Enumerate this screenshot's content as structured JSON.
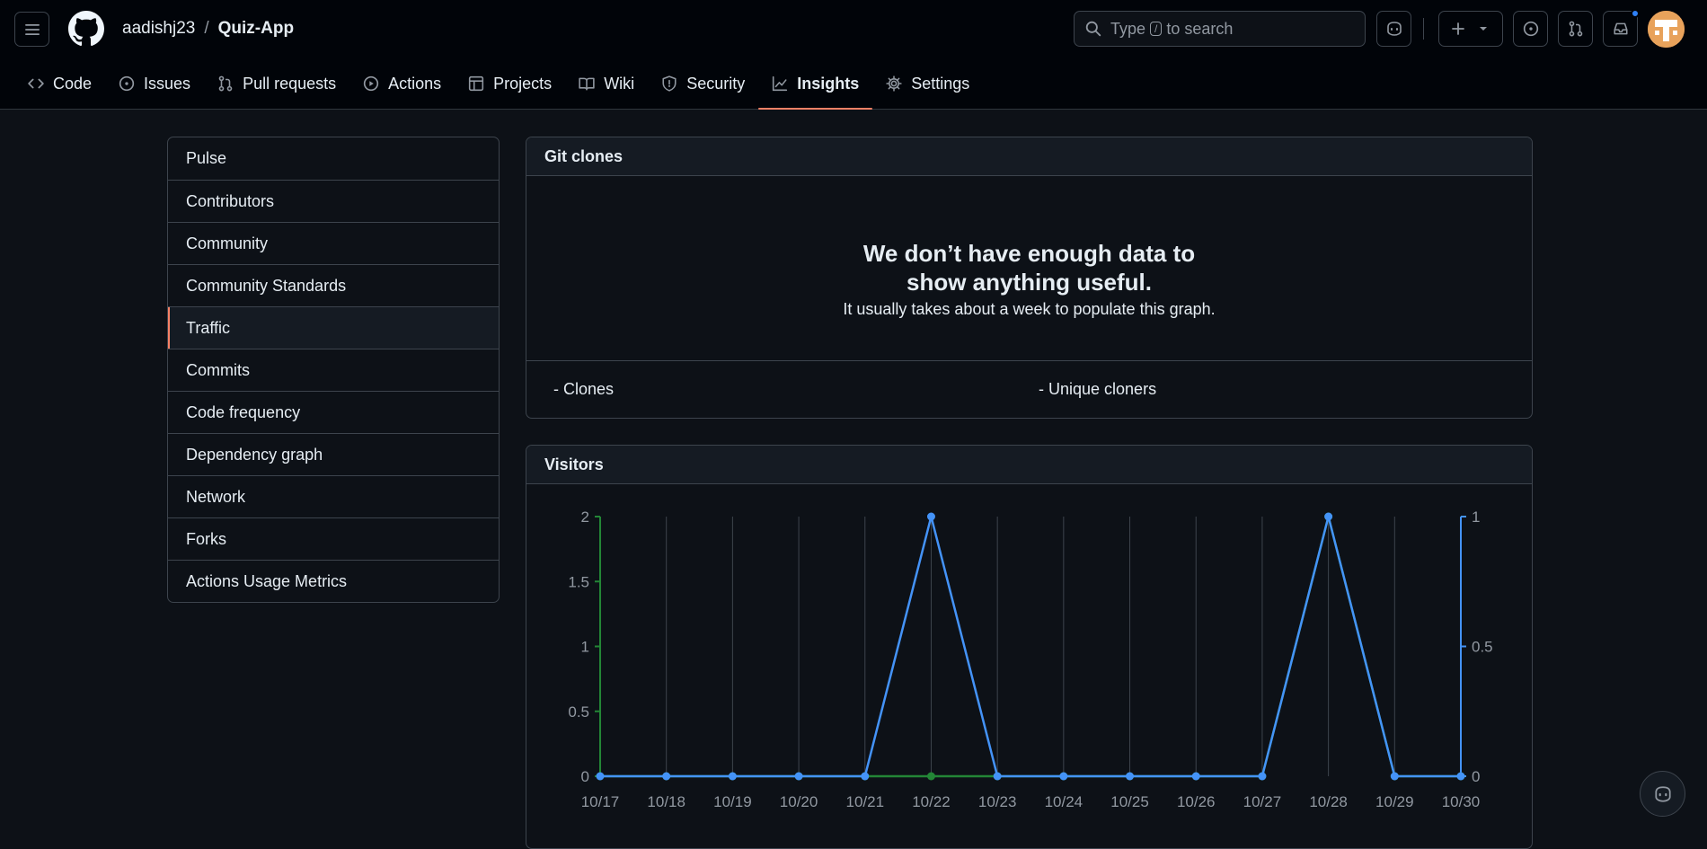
{
  "header": {
    "owner": "aadishj23",
    "separator": "/",
    "repo": "Quiz-App",
    "search": {
      "before": "Type",
      "key": "/",
      "after": "to search"
    }
  },
  "tabs": [
    {
      "label": "Code",
      "icon": "code-icon"
    },
    {
      "label": "Issues",
      "icon": "issue-icon"
    },
    {
      "label": "Pull requests",
      "icon": "pull-request-icon"
    },
    {
      "label": "Actions",
      "icon": "play-icon"
    },
    {
      "label": "Projects",
      "icon": "table-icon"
    },
    {
      "label": "Wiki",
      "icon": "book-icon"
    },
    {
      "label": "Security",
      "icon": "shield-icon"
    },
    {
      "label": "Insights",
      "icon": "graph-icon",
      "active": true
    },
    {
      "label": "Settings",
      "icon": "gear-icon"
    }
  ],
  "sidebar": {
    "items": [
      {
        "label": "Pulse"
      },
      {
        "label": "Contributors"
      },
      {
        "label": "Community"
      },
      {
        "label": "Community Standards"
      },
      {
        "label": "Traffic",
        "active": true
      },
      {
        "label": "Commits"
      },
      {
        "label": "Code frequency"
      },
      {
        "label": "Dependency graph"
      },
      {
        "label": "Network"
      },
      {
        "label": "Forks"
      },
      {
        "label": "Actions Usage Metrics"
      }
    ]
  },
  "clones": {
    "title": "Git clones",
    "blank_heading": "We don’t have enough data to show anything useful.",
    "blank_text": "It usually takes about a week to populate this graph.",
    "legend_clones": "- Clones",
    "legend_unique": "- Unique cloners"
  },
  "visitors": {
    "title": "Visitors"
  },
  "colors": {
    "accent": "#f78166",
    "views_line": "#4493f8",
    "unique_line": "#238636"
  },
  "chart_data": {
    "type": "line",
    "x": [
      "10/17",
      "10/18",
      "10/19",
      "10/20",
      "10/21",
      "10/22",
      "10/23",
      "10/24",
      "10/25",
      "10/26",
      "10/27",
      "10/28",
      "10/29",
      "10/30"
    ],
    "series": [
      {
        "values": [
          0,
          0,
          0,
          0,
          0,
          2,
          0,
          0,
          0,
          0,
          0,
          2,
          0,
          0
        ],
        "color": "#4493f8"
      },
      {
        "values": [
          0,
          0,
          0,
          0,
          0,
          0,
          0,
          0,
          0,
          0,
          0,
          1,
          0,
          0
        ],
        "color": "#238636"
      }
    ],
    "y_left": {
      "ticks": [
        "2",
        "1.5",
        "1",
        "0.5",
        "0"
      ],
      "ylim": [
        0,
        2
      ]
    },
    "y_right": {
      "ticks": [
        "1",
        "0.5",
        "0"
      ],
      "ylim": [
        0,
        1
      ]
    },
    "grid": "vertical"
  }
}
